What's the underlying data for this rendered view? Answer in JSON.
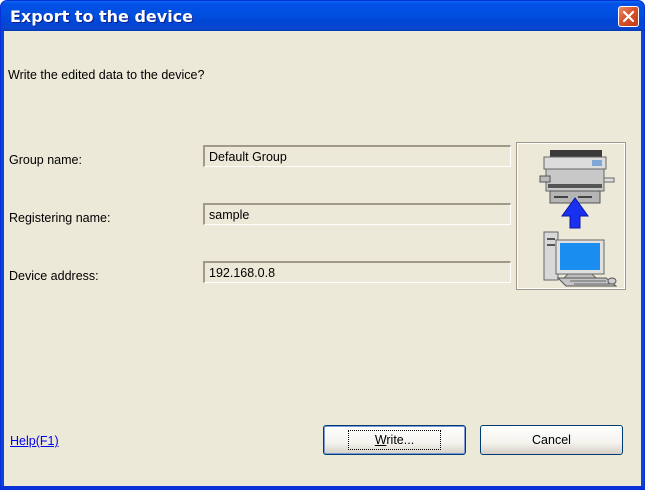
{
  "window": {
    "title": "Export to the device"
  },
  "dialog": {
    "prompt": "Write the edited data to the device?",
    "fields": [
      {
        "label": "Group name:",
        "value": "Default Group"
      },
      {
        "label": "Registering name:",
        "value": "sample"
      },
      {
        "label": "Device address:",
        "value": "192.168.0.8"
      }
    ],
    "help_link": "Help(F1)",
    "write_button": {
      "mnemonic": "W",
      "rest": "rite..."
    },
    "cancel_button": "Cancel"
  },
  "icons": {
    "close": "close-icon",
    "illustration": "computer-to-printer-upload-illustration"
  },
  "colors": {
    "title_bar": "#0150e0",
    "dialog_bg": "#ece9d8",
    "close_button": "#d9542c",
    "arrow": "#1a30f0",
    "link": "#0000ee"
  }
}
